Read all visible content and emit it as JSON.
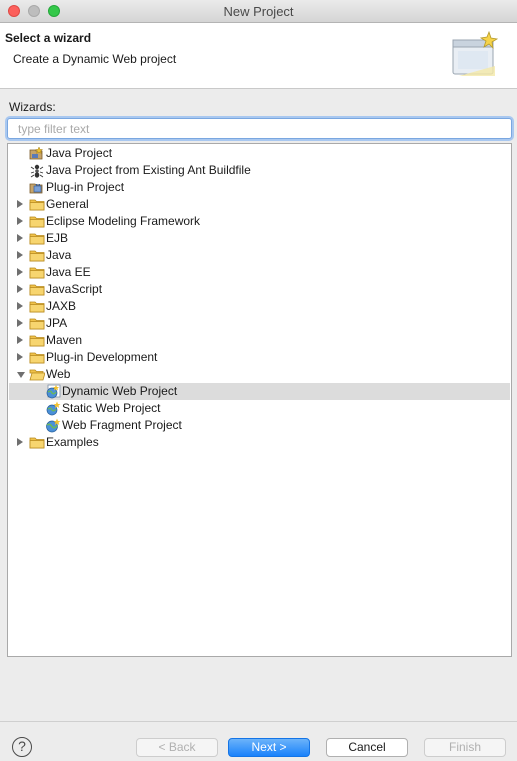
{
  "window": {
    "title": "New Project"
  },
  "header": {
    "title": "Select a wizard",
    "description": "Create a Dynamic Web project"
  },
  "wizards": {
    "label": "Wizards:",
    "filter_placeholder": "type filter text",
    "items": [
      {
        "label": "Java Project",
        "depth": 0,
        "expander": "none",
        "icon": "java-project-icon",
        "selected": false
      },
      {
        "label": "Java Project from Existing Ant Buildfile",
        "depth": 0,
        "expander": "none",
        "icon": "ant-icon",
        "selected": false
      },
      {
        "label": "Plug-in Project",
        "depth": 0,
        "expander": "none",
        "icon": "plugin-project-icon",
        "selected": false
      },
      {
        "label": "General",
        "depth": 0,
        "expander": "closed",
        "icon": "folder-icon",
        "selected": false
      },
      {
        "label": "Eclipse Modeling Framework",
        "depth": 0,
        "expander": "closed",
        "icon": "folder-icon",
        "selected": false
      },
      {
        "label": "EJB",
        "depth": 0,
        "expander": "closed",
        "icon": "folder-icon",
        "selected": false
      },
      {
        "label": "Java",
        "depth": 0,
        "expander": "closed",
        "icon": "folder-icon",
        "selected": false
      },
      {
        "label": "Java EE",
        "depth": 0,
        "expander": "closed",
        "icon": "folder-icon",
        "selected": false
      },
      {
        "label": "JavaScript",
        "depth": 0,
        "expander": "closed",
        "icon": "folder-icon",
        "selected": false
      },
      {
        "label": "JAXB",
        "depth": 0,
        "expander": "closed",
        "icon": "folder-icon",
        "selected": false
      },
      {
        "label": "JPA",
        "depth": 0,
        "expander": "closed",
        "icon": "folder-icon",
        "selected": false
      },
      {
        "label": "Maven",
        "depth": 0,
        "expander": "closed",
        "icon": "folder-icon",
        "selected": false
      },
      {
        "label": "Plug-in Development",
        "depth": 0,
        "expander": "closed",
        "icon": "folder-icon",
        "selected": false
      },
      {
        "label": "Web",
        "depth": 0,
        "expander": "open",
        "icon": "folder-open-icon",
        "selected": false
      },
      {
        "label": "Dynamic Web Project",
        "depth": 1,
        "expander": "none",
        "icon": "dynamic-web-project-icon",
        "selected": true
      },
      {
        "label": "Static Web Project",
        "depth": 1,
        "expander": "none",
        "icon": "static-web-project-icon",
        "selected": false
      },
      {
        "label": "Web Fragment Project",
        "depth": 1,
        "expander": "none",
        "icon": "web-fragment-project-icon",
        "selected": false
      },
      {
        "label": "Examples",
        "depth": 0,
        "expander": "closed",
        "icon": "folder-icon",
        "selected": false
      }
    ]
  },
  "footer": {
    "help_glyph": "?",
    "back_label": "< Back",
    "next_label": "Next >",
    "cancel_label": "Cancel",
    "finish_label": "Finish"
  },
  "colors": {
    "primary_button": "#1a82fb",
    "selection": "#dcdcdc",
    "folder": "#f0c24a"
  }
}
